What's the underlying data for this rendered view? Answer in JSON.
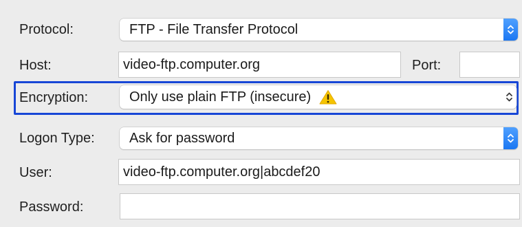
{
  "protocol": {
    "label": "Protocol:",
    "value": "FTP - File Transfer Protocol"
  },
  "host": {
    "label": "Host:",
    "value": "video-ftp.computer.org",
    "port_label": "Port:",
    "port_value": ""
  },
  "encryption": {
    "label": "Encryption:",
    "value": "Only use plain FTP (insecure)",
    "icon": "warning-icon",
    "highlight_color": "#1746d6"
  },
  "logon_type": {
    "label": "Logon Type:",
    "value": "Ask for password"
  },
  "user": {
    "label": "User:",
    "value": "video-ftp.computer.org|abcdef20"
  },
  "password": {
    "label": "Password:",
    "value": ""
  },
  "colors": {
    "accent": "#1b77f2",
    "warning": "#f5c400"
  }
}
